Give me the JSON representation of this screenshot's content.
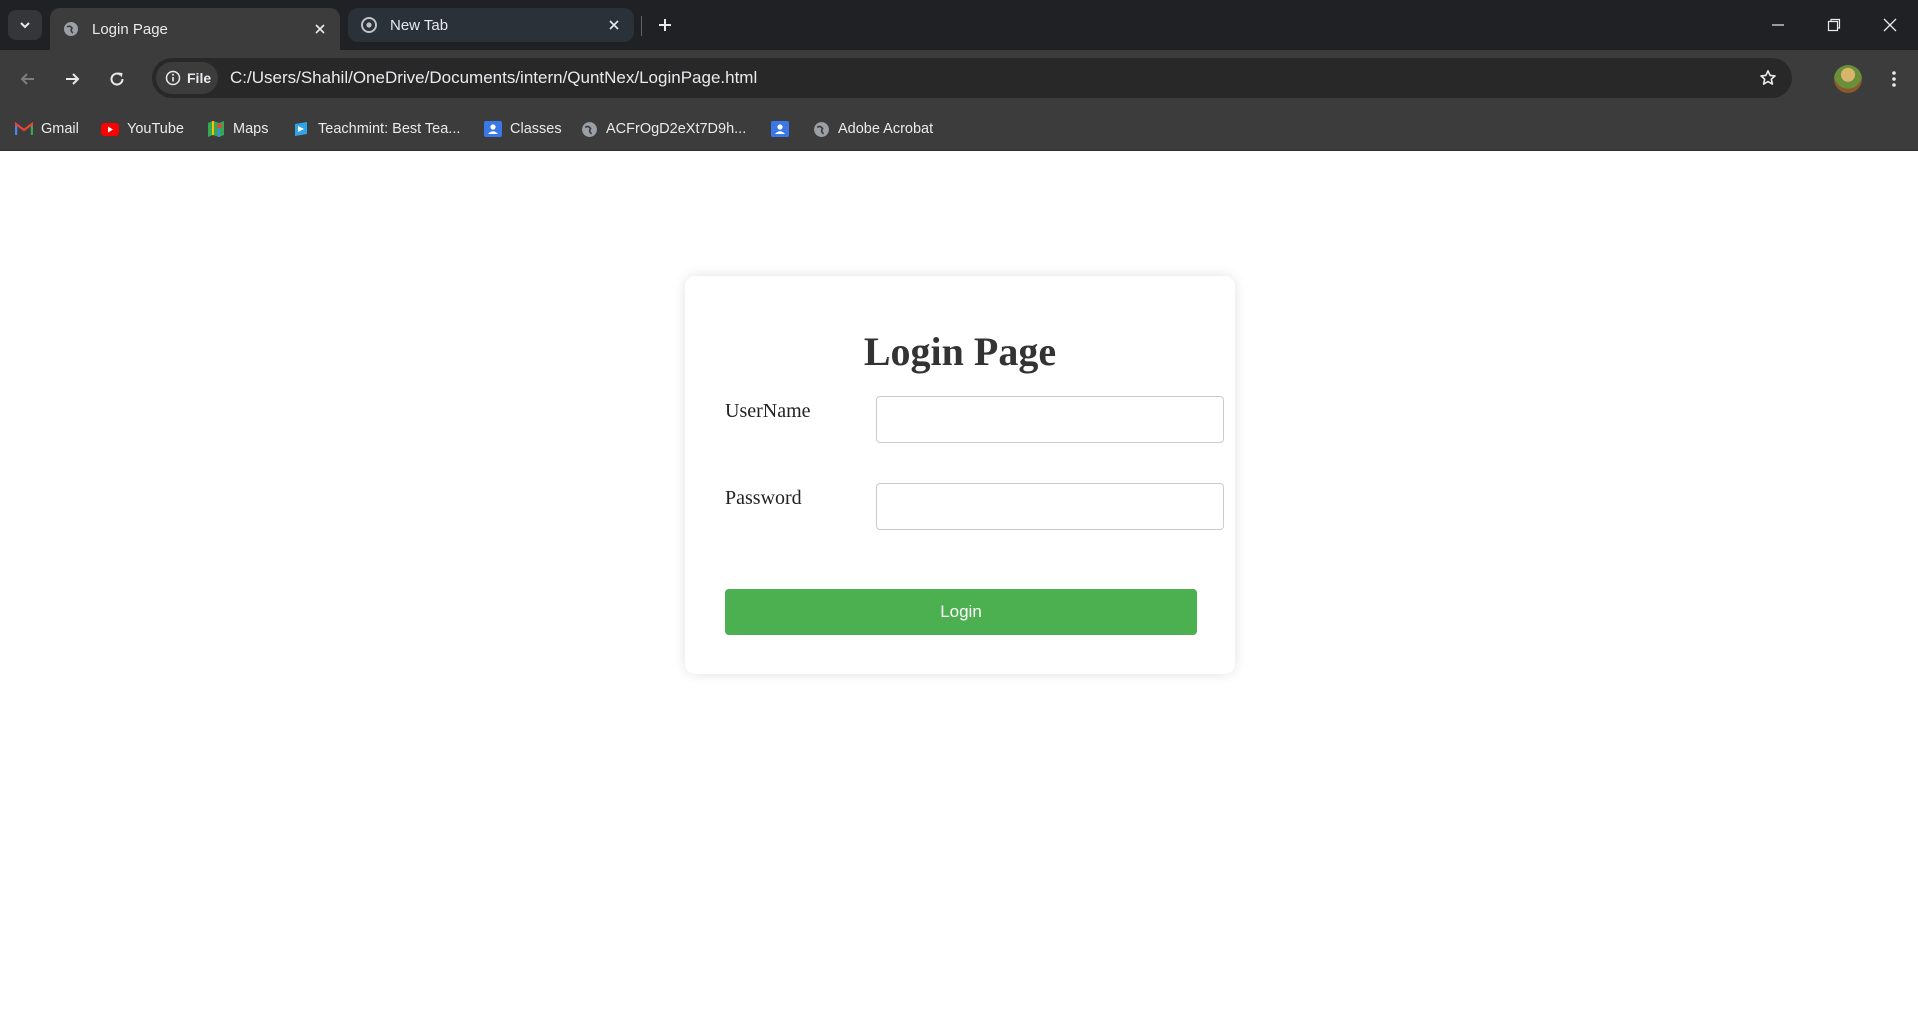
{
  "browser": {
    "tabs": [
      {
        "title": "Login Page",
        "favicon": "globe-icon",
        "active": true
      },
      {
        "title": "New Tab",
        "favicon": "chrome-icon",
        "active": false
      }
    ],
    "address_chip": "File",
    "url": "C:/Users/Shahil/OneDrive/Documents/intern/QuntNex/LoginPage.html",
    "bookmarks": [
      {
        "label": "Gmail",
        "icon": "gmail-icon"
      },
      {
        "label": "YouTube",
        "icon": "youtube-icon"
      },
      {
        "label": "Maps",
        "icon": "maps-icon"
      },
      {
        "label": "Teachmint: Best Tea...",
        "icon": "teachmint-icon"
      },
      {
        "label": "Classes",
        "icon": "classes-icon"
      },
      {
        "label": "ACFrOgD2eXt7D9h...",
        "icon": "globe-icon"
      },
      {
        "label": "",
        "icon": "classes-icon"
      },
      {
        "label": "Adobe Acrobat",
        "icon": "globe-icon"
      }
    ]
  },
  "login": {
    "title": "Login Page",
    "username_label": "UserName",
    "username_value": "",
    "password_label": "Password",
    "password_value": "",
    "button_label": "Login"
  },
  "colors": {
    "button": "#4caf50",
    "browser_frame": "#202124",
    "toolbar": "#3c3c3c"
  }
}
